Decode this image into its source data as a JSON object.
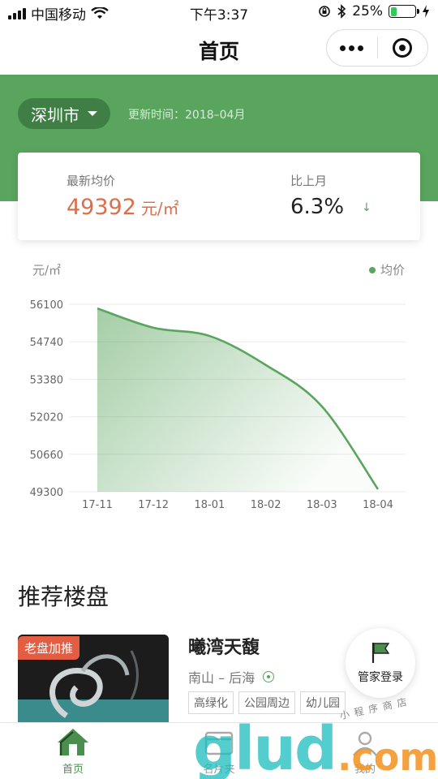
{
  "status_bar": {
    "carrier": "中国移动",
    "time": "下午3:37",
    "battery": "25%",
    "battery_level": 0.25
  },
  "navbar": {
    "title": "首页",
    "icons": [
      "more-icon",
      "close-target-icon"
    ]
  },
  "header": {
    "city": "深圳市",
    "update_label": "更新时间：2018–04月"
  },
  "price_card": {
    "latest_label": "最新均价",
    "latest_value": "49392",
    "unit": "元/㎡",
    "mom_label": "比上月",
    "mom_value": "6.3%",
    "mom_arrow": "↓"
  },
  "chart_data": {
    "type": "area",
    "ylabel": "元/㎡",
    "legend": [
      "均价"
    ],
    "legend_position": "top-right",
    "grid": true,
    "categories": [
      "17-11",
      "17-12",
      "18-01",
      "18-02",
      "18-03",
      "18-04"
    ],
    "series": [
      {
        "name": "均价",
        "values": [
          55950,
          55250,
          54950,
          53900,
          52400,
          49392
        ]
      }
    ],
    "yticks": [
      56100,
      54740,
      53380,
      52020,
      50660,
      49300
    ],
    "ylim": [
      49300,
      56100
    ],
    "color": "#5aa55e"
  },
  "recommend": {
    "section_title": "推荐楼盘",
    "listing": {
      "badge": "老盘加推",
      "name": "曦湾天馥",
      "location": "南山 – 后海",
      "tags": [
        "高绿化",
        "公园周边",
        "幼儿园"
      ]
    }
  },
  "steward_button": {
    "label": "管家登录"
  },
  "tabbar": {
    "tabs": [
      {
        "label": "首页",
        "icon": "home-icon",
        "active": true
      },
      {
        "label": "名片夹",
        "icon": "card-icon",
        "active": false
      },
      {
        "label": "我的",
        "icon": "user-icon",
        "active": false
      }
    ]
  },
  "watermark": {
    "main": "glud",
    "suffix": ".com",
    "small": "小程序商店"
  }
}
